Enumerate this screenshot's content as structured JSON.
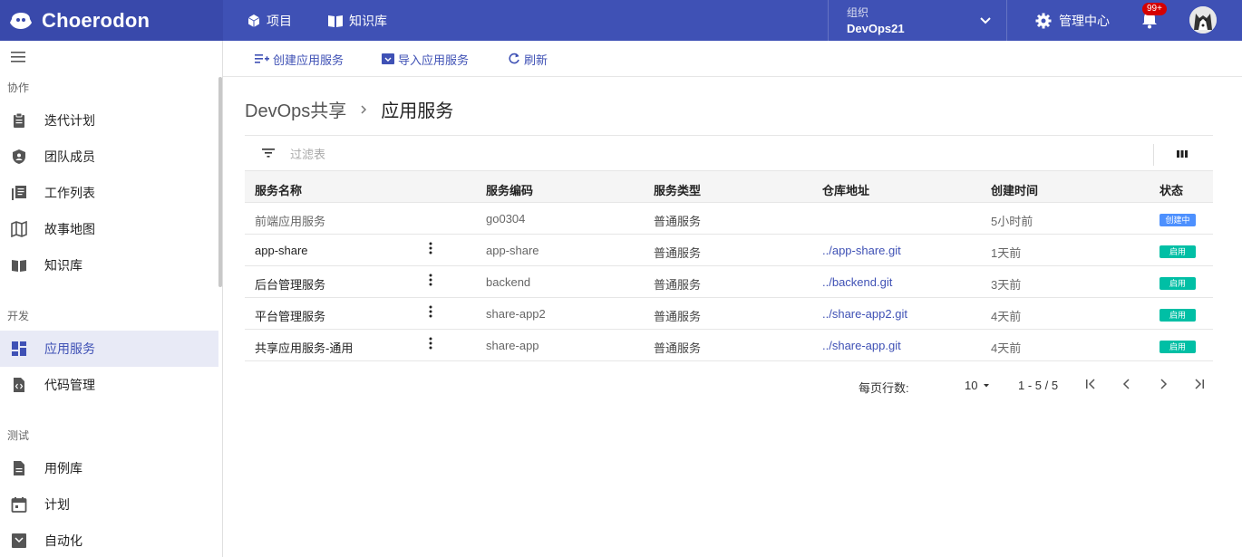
{
  "header": {
    "logo": "Choerodon",
    "nav": [
      {
        "label": "项目",
        "icon": "cube-icon"
      },
      {
        "label": "知识库",
        "icon": "book-icon"
      }
    ],
    "org": {
      "label": "组织",
      "value": "DevOps21"
    },
    "management": "管理中心",
    "notifications_badge": "99+"
  },
  "sidebar": {
    "sections": [
      {
        "title": "协作",
        "items": [
          "迭代计划",
          "团队成员",
          "工作列表",
          "故事地图",
          "知识库"
        ]
      },
      {
        "title": "开发",
        "items": [
          "应用服务",
          "代码管理"
        ]
      },
      {
        "title": "测试",
        "items": [
          "用例库",
          "计划",
          "自动化"
        ]
      }
    ],
    "active": "应用服务"
  },
  "toolbar": {
    "create": "创建应用服务",
    "import": "导入应用服务",
    "refresh": "刷新"
  },
  "breadcrumb": {
    "parent": "DevOps共享",
    "current": "应用服务"
  },
  "filter": {
    "placeholder": "过滤表"
  },
  "table": {
    "headers": [
      "服务名称",
      "服务编码",
      "服务类型",
      "仓库地址",
      "创建时间",
      "状态"
    ],
    "rows": [
      {
        "name": "前端应用服务",
        "code": "go0304",
        "type": "普通服务",
        "repo": "",
        "time": "5小时前",
        "status": "创建中",
        "status_color": "#4d90fe",
        "disabled": true
      },
      {
        "name": "app-share",
        "code": "app-share",
        "type": "普通服务",
        "repo": "../app-share.git",
        "time": "1天前",
        "status": "启用",
        "status_color": "#00bfa5",
        "disabled": false
      },
      {
        "name": "后台管理服务",
        "code": "backend",
        "type": "普通服务",
        "repo": "../backend.git",
        "time": "3天前",
        "status": "启用",
        "status_color": "#00bfa5",
        "disabled": false
      },
      {
        "name": "平台管理服务",
        "code": "share-app2",
        "type": "普通服务",
        "repo": "../share-app2.git",
        "time": "4天前",
        "status": "启用",
        "status_color": "#00bfa5",
        "disabled": false
      },
      {
        "name": "共享应用服务-通用",
        "code": "share-app",
        "type": "普通服务",
        "repo": "../share-app.git",
        "time": "4天前",
        "status": "启用",
        "status_color": "#00bfa5",
        "disabled": false
      }
    ]
  },
  "pagination": {
    "label": "每页行数:",
    "page_size": "10",
    "range": "1 - 5 / 5"
  },
  "colors": {
    "primary": "#3f51b5",
    "header_logo_bg": "#3949ab",
    "active_bg": "#e8eaf6",
    "enabled": "#00bfa5",
    "creating": "#4d90fe"
  }
}
